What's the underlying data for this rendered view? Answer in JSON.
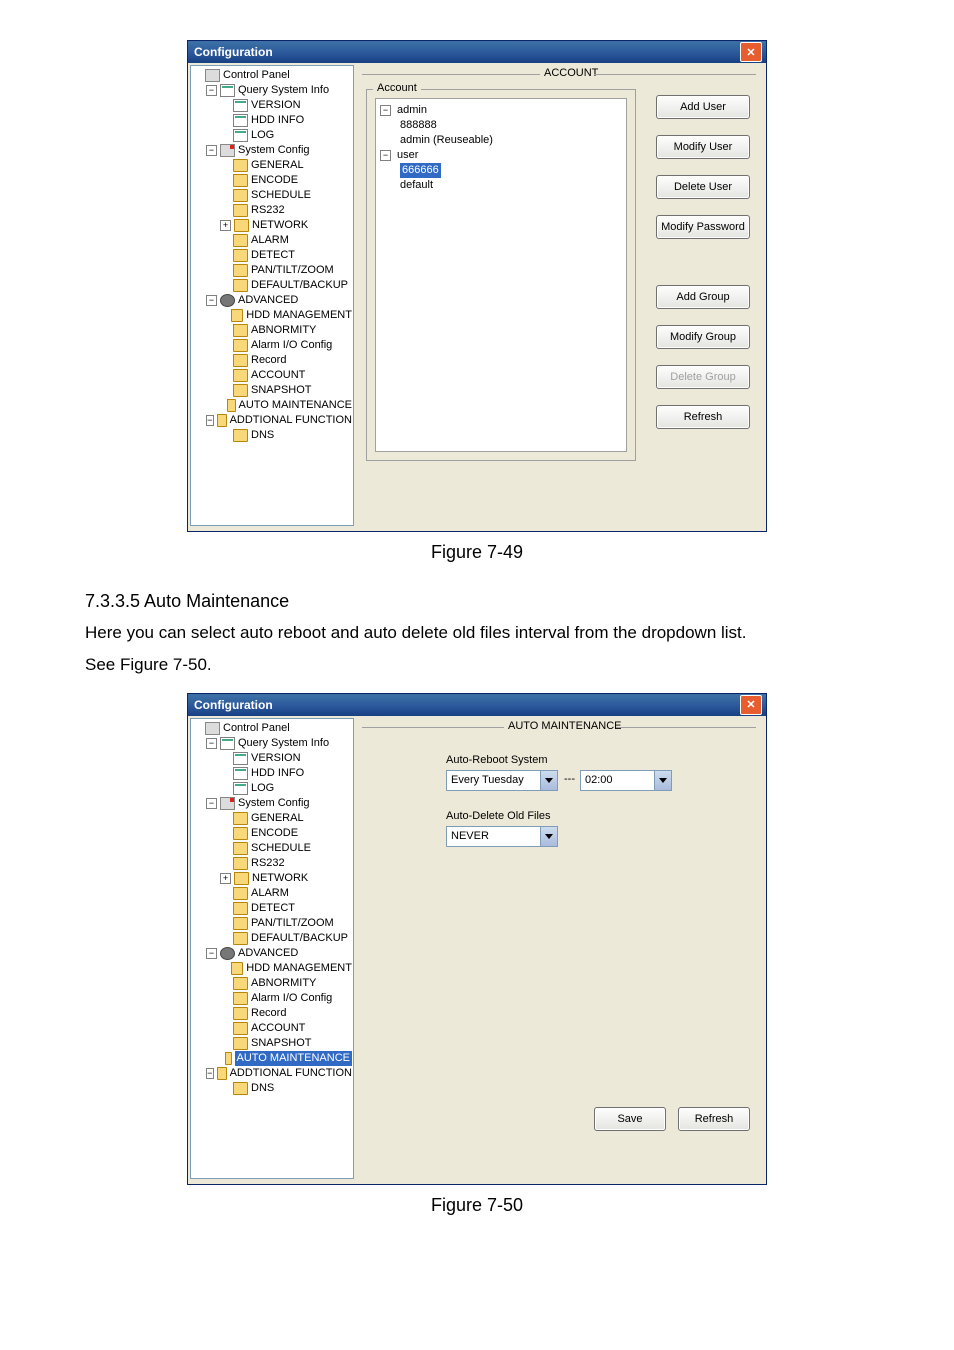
{
  "figure1": {
    "caption": "Figure 7-49",
    "window_title": "Configuration",
    "panel_title": "ACCOUNT",
    "fieldset_label": "Account",
    "tree": {
      "root": "Control Panel",
      "g1": "Query System Info",
      "g1a": "VERSION",
      "g1b": "HDD INFO",
      "g1c": "LOG",
      "g2": "System Config",
      "g2a": "GENERAL",
      "g2b": "ENCODE",
      "g2c": "SCHEDULE",
      "g2d": "RS232",
      "g2e": "NETWORK",
      "g2f": "ALARM",
      "g2g": "DETECT",
      "g2h": "PAN/TILT/ZOOM",
      "g2i": "DEFAULT/BACKUP",
      "g3": "ADVANCED",
      "g3a": "HDD MANAGEMENT",
      "g3b": "ABNORMITY",
      "g3c": "Alarm I/O Config",
      "g3d": "Record",
      "g3e": "ACCOUNT",
      "g3f": "SNAPSHOT",
      "g3g": "AUTO MAINTENANCE",
      "g4": "ADDTIONAL FUNCTION",
      "g4a": "DNS"
    },
    "accounts": {
      "admin": "admin",
      "admin_num": "888888",
      "admin_reuse": "admin (Reuseable)",
      "user": "user",
      "user_num": "666666",
      "default": "default"
    },
    "buttons": {
      "add_user": "Add User",
      "modify_user": "Modify User",
      "delete_user": "Delete User",
      "modify_password": "Modify Password",
      "add_group": "Add Group",
      "modify_group": "Modify Group",
      "delete_group": "Delete Group",
      "refresh": "Refresh"
    }
  },
  "section": {
    "number": "7.3.3.5  Auto Maintenance",
    "text1": "Here you can select auto reboot and auto delete old files interval from the dropdown list.",
    "text2": "See Figure 7-50."
  },
  "figure2": {
    "caption": "Figure 7-50",
    "window_title": "Configuration",
    "panel_title": "AUTO MAINTENANCE",
    "label_reboot": "Auto-Reboot System",
    "combo_day": "Every Tuesday",
    "sep": "---",
    "combo_time": "02:00",
    "label_delete": "Auto-Delete Old Files",
    "combo_never": "NEVER",
    "btn_save": "Save",
    "btn_refresh": "Refresh",
    "tree": {
      "root": "Control Panel",
      "g1": "Query System Info",
      "g1a": "VERSION",
      "g1b": "HDD INFO",
      "g1c": "LOG",
      "g2": "System Config",
      "g2a": "GENERAL",
      "g2b": "ENCODE",
      "g2c": "SCHEDULE",
      "g2d": "RS232",
      "g2e": "NETWORK",
      "g2f": "ALARM",
      "g2g": "DETECT",
      "g2h": "PAN/TILT/ZOOM",
      "g2i": "DEFAULT/BACKUP",
      "g3": "ADVANCED",
      "g3a": "HDD MANAGEMENT",
      "g3b": "ABNORMITY",
      "g3c": "Alarm I/O Config",
      "g3d": "Record",
      "g3e": "ACCOUNT",
      "g3f": "SNAPSHOT",
      "g3g": "AUTO MAINTENANCE",
      "g4": "ADDTIONAL FUNCTION",
      "g4a": "DNS"
    }
  }
}
